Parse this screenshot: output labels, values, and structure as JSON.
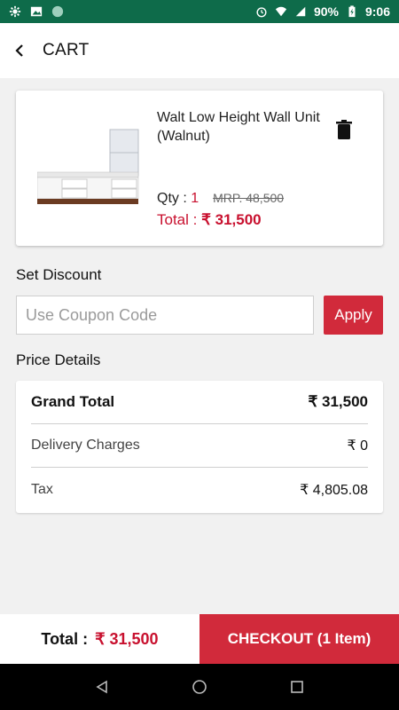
{
  "status_bar": {
    "battery": "90%",
    "time": "9:06"
  },
  "header": {
    "title": "CART"
  },
  "cart_item": {
    "name": "Walt Low Height Wall Unit (Walnut)",
    "qty_label": "Qty :",
    "qty_value": "1",
    "mrp": "MRP. 48,500",
    "total_label": "Total :",
    "total_value": "₹ 31,500"
  },
  "discount": {
    "section_title": "Set Discount",
    "placeholder": "Use Coupon Code",
    "apply_label": "Apply"
  },
  "price_details": {
    "section_title": "Price Details",
    "rows": [
      {
        "label": "Grand Total",
        "value": "₹ 31,500"
      },
      {
        "label": "Delivery Charges",
        "value": "₹ 0"
      },
      {
        "label": "Tax",
        "value": "₹ 4,805.08"
      }
    ]
  },
  "footer": {
    "total_label": "Total :",
    "total_value": "₹ 31,500",
    "checkout_label": "CHECKOUT (1 Item)"
  },
  "colors": {
    "brand_green": "#0e6b4a",
    "accent_red": "#d12a3b",
    "price_red": "#c8102e"
  },
  "icons": [
    "settings-icon",
    "image-icon",
    "circle-icon",
    "alarm-icon",
    "wifi-icon",
    "signal-icon",
    "battery-icon",
    "back-arrow-icon",
    "trash-icon",
    "nav-back-icon",
    "nav-home-icon",
    "nav-recents-icon"
  ]
}
